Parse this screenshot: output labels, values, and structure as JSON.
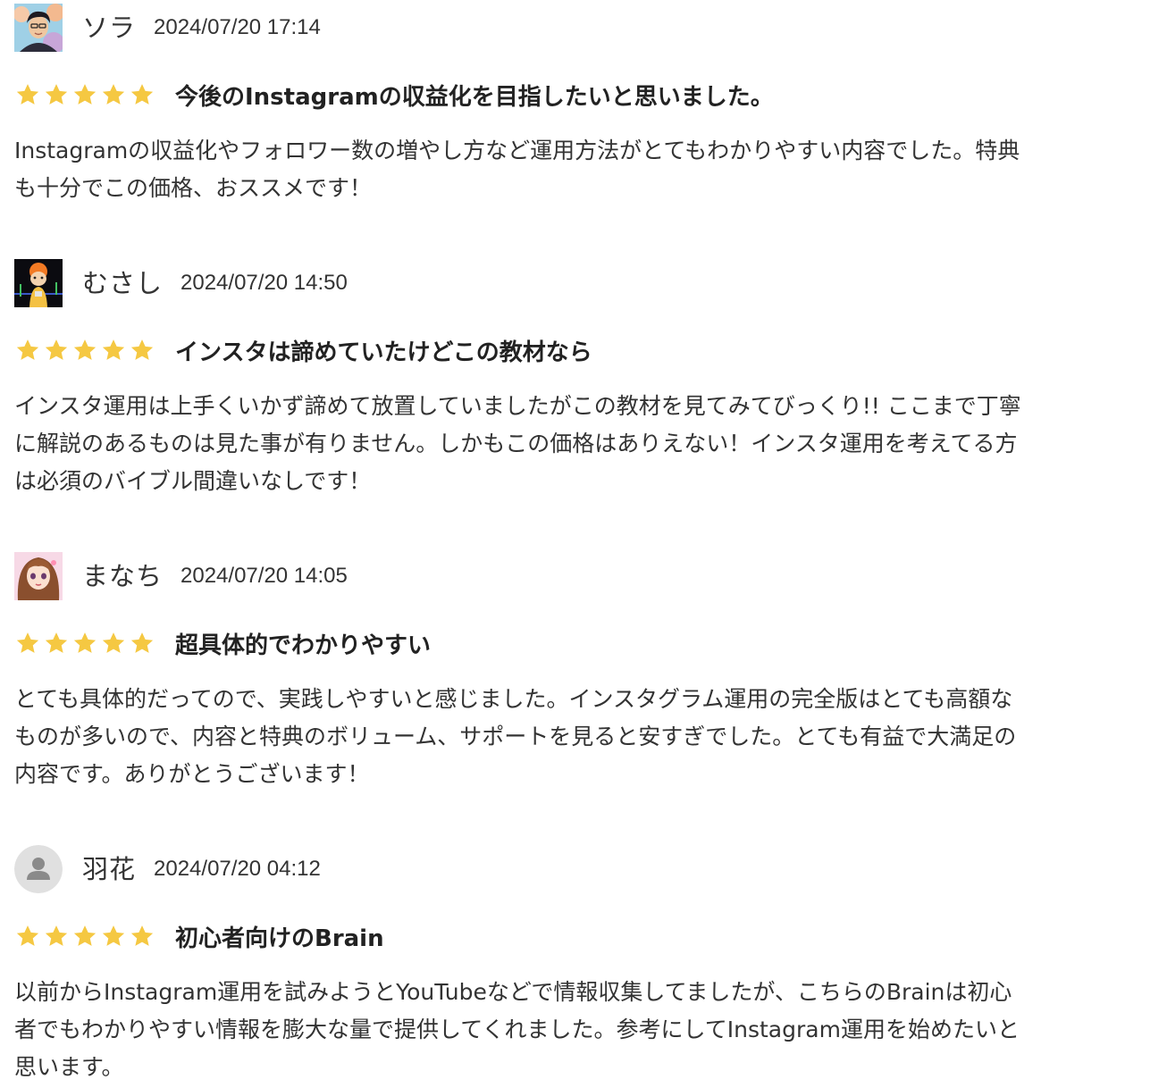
{
  "colors": {
    "star": "#f5c842",
    "text": "#333333",
    "default_avatar_bg": "#e0e0e0",
    "default_avatar_fg": "#8a8a8a"
  },
  "reviews": [
    {
      "name": "ソラ",
      "date": "2024/07/20 17:14",
      "rating": 5,
      "title": "今後のInstagramの収益化を目指したいと思いました。",
      "body_lines": [
        "Instagramの収益化やフォロワー数の増やし方など運用方法がとてもわかりやすい内容でした。特典",
        "も十分でこの価格、おススメです！"
      ],
      "avatar": "illustrated-man-avatar"
    },
    {
      "name": "むさし",
      "date": "2024/07/20 14:50",
      "rating": 5,
      "title": "インスタは諦めていたけどこの教材なら",
      "body_lines": [
        "インスタ運用は上手くいかず諦めて放置していましたがこの教材を見てみてびっくり!! ここまで丁寧",
        "に解説のあるものは見た事が有りません。しかもこの価格はありえない！インスタ運用を考えてる方",
        "は必須のバイブル間違いなしです！"
      ],
      "avatar": "cartoon-character-avatar"
    },
    {
      "name": "まなち",
      "date": "2024/07/20 14:05",
      "rating": 5,
      "title": "超具体的でわかりやすい",
      "body_lines": [
        "とても具体的だってので、実践しやすいと感じました。インスタグラム運用の完全版はとても高額な",
        "ものが多いので、内容と特典のボリューム、サポートを見ると安すぎでした。とても有益で大満足の",
        "内容です。ありがとうございます！"
      ],
      "avatar": "anime-girl-avatar"
    },
    {
      "name": "羽花",
      "date": "2024/07/20 04:12",
      "rating": 5,
      "title": "初心者向けのBrain",
      "body_lines": [
        "以前からInstagram運用を試みようとYouTubeなどで情報収集してましたが、こちらのBrainは初心",
        "者でもわかりやすい情報を膨大な量で提供してくれました。参考にしてInstagram運用を始めたいと",
        "思います。"
      ],
      "avatar": "default-user-icon"
    }
  ]
}
